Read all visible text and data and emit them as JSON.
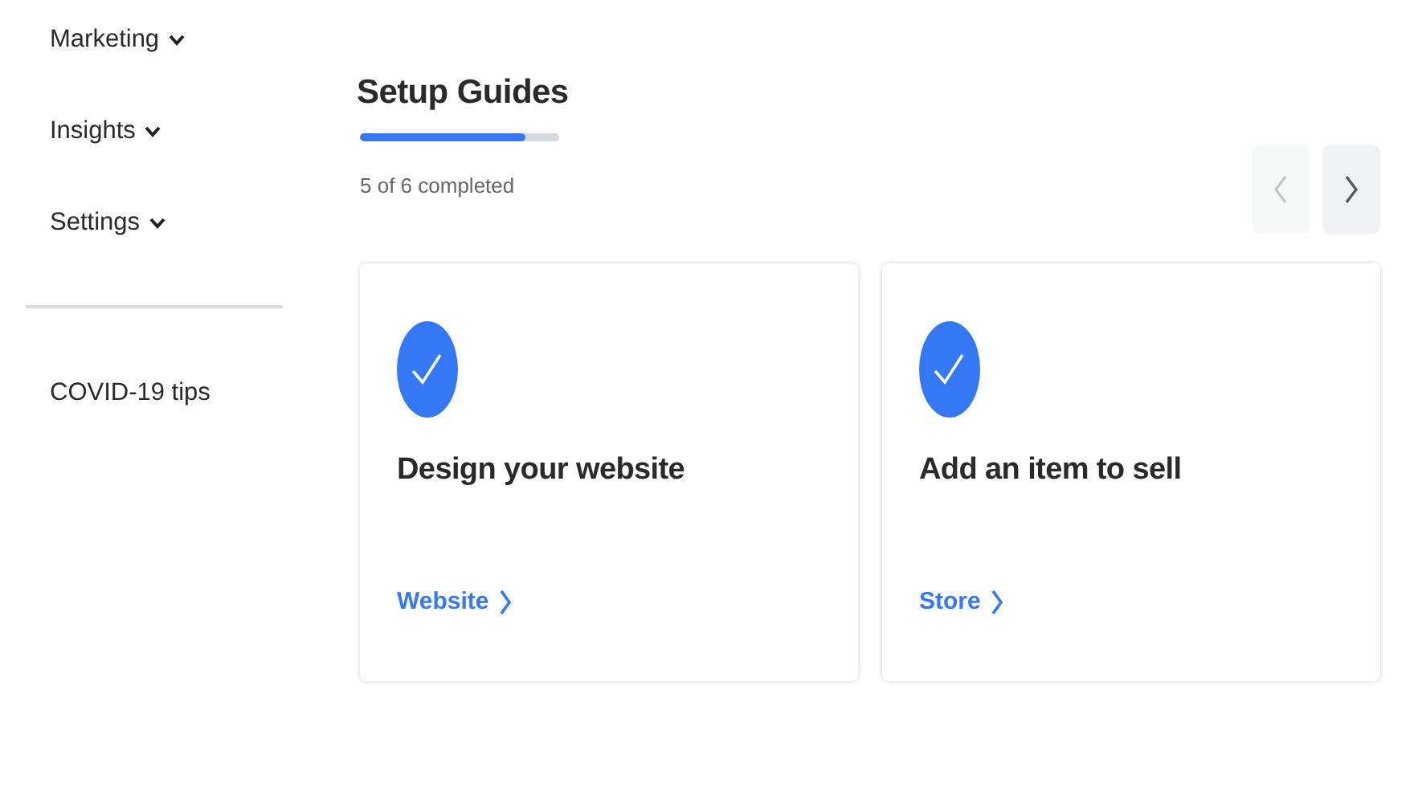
{
  "sidebar": {
    "menus": [
      {
        "label": "Marketing"
      },
      {
        "label": "Insights"
      },
      {
        "label": "Settings"
      }
    ],
    "links": [
      {
        "label": "COVID-19 tips"
      }
    ]
  },
  "setup_guides": {
    "title": "Setup Guides",
    "progress": {
      "level": 0.83
    },
    "status": "5 of 6 completed",
    "nav": {
      "prev": {
        "disabled": true
      },
      "next": {
        "disabled": false
      }
    },
    "cards": [
      {
        "title": "Design your website",
        "completed": true,
        "link": "Website"
      },
      {
        "title": "Add an item to sell",
        "completed": true,
        "link": "Store"
      }
    ]
  }
}
